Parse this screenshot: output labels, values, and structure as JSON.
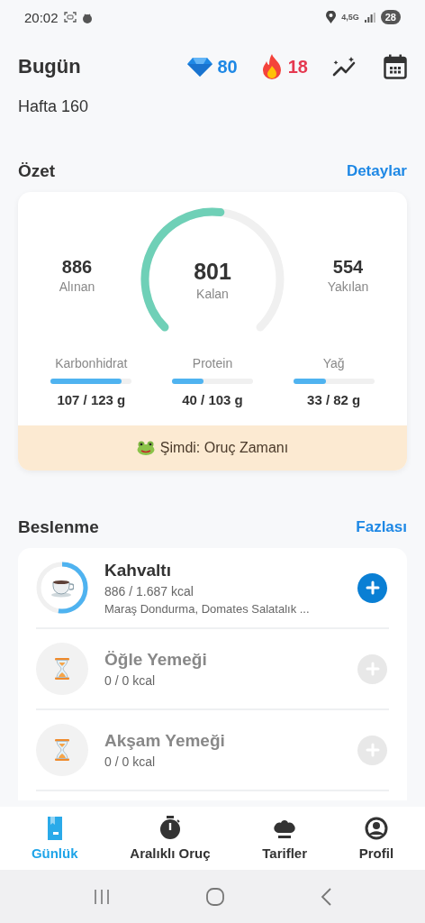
{
  "status_bar": {
    "time": "20:02",
    "network": "4,5G",
    "battery": "28"
  },
  "header": {
    "title": "Bugün",
    "gems": "80",
    "streak": "18",
    "subtitle": "Hafta 160"
  },
  "summary": {
    "title": "Özet",
    "link": "Detaylar",
    "eaten": {
      "value": "886",
      "label": "Alınan"
    },
    "remaining": {
      "value": "801",
      "label": "Kalan"
    },
    "burned": {
      "value": "554",
      "label": "Yakılan"
    },
    "macros": [
      {
        "name": "Karbonhidrat",
        "level": 0.87,
        "reading": "107 / 123 g"
      },
      {
        "name": "Protein",
        "level": 0.39,
        "reading": "40 / 103 g"
      },
      {
        "name": "Yağ",
        "level": 0.4,
        "reading": "33 / 82 g"
      }
    ],
    "banner": "Şimdi: Oruç Zamanı"
  },
  "nutrition": {
    "title": "Beslenme",
    "link": "Fazlası",
    "meals": [
      {
        "name": "Kahvaltı",
        "kcal": "886 / 1.687 kcal",
        "foods": "Maraş Dondurma, Domates Salatalık ...",
        "logged": true
      },
      {
        "name": "Öğle Yemeği",
        "kcal": "0 / 0 kcal",
        "logged": false
      },
      {
        "name": "Akşam Yemeği",
        "kcal": "0 / 0 kcal",
        "logged": false
      }
    ]
  },
  "tabs": [
    {
      "label": "Günlük",
      "selected": true
    },
    {
      "label": "Aralıklı Oruç",
      "selected": false
    },
    {
      "label": "Tarifler",
      "selected": false
    },
    {
      "label": "Profil",
      "selected": false
    }
  ]
}
